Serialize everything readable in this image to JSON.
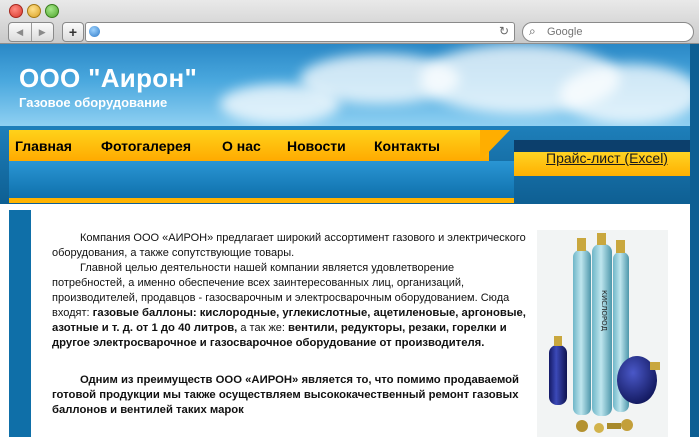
{
  "browser": {
    "search_placeholder": "Google",
    "back_glyph": "◀",
    "forward_glyph": "▶",
    "plus_glyph": "+",
    "reload_glyph": "↻",
    "search_glyph": "⌕"
  },
  "header": {
    "title": "ООО \"Аирон\"",
    "subtitle": "Газовое оборудование"
  },
  "nav": {
    "items": [
      "Главная",
      "Фотогалерея",
      "О нас",
      "Новости",
      "Контакты"
    ]
  },
  "price_link": "Прайс-лист (Excel)",
  "content": {
    "p1": "Компания ООО «АИРОН» предлагает широкий ассортимент газового и электрического оборудования, а также сопутствующие товары.",
    "p2_lead": "Главной целью деятельности нашей компании является удовлетворение потребностей, а именно обеспечение всех заинтересованных лиц, организаций, производителей, продавцов - газосварочным и электросварочным оборудованием. Сюда входят: ",
    "p2_bold1": "газовые баллоны: кислородные, углекислотные, ацетиленовые, аргоновые, азотные и т. д.  от 1 до 40 литров,",
    "p2_mid": " а так же: ",
    "p2_bold2": "вентили, редукторы, резаки, горелки и другое электросварочное и газосварочное оборудование от производителя.",
    "p3": "Одним из преимуществ ООО «АИРОН» является то, что помимо продаваемой готовой продукции мы также осуществляем высококачественный ремонт газовых баллонов и вентилей таких марок"
  },
  "photo": {
    "cylinder_label": "КИСЛОРОД"
  }
}
